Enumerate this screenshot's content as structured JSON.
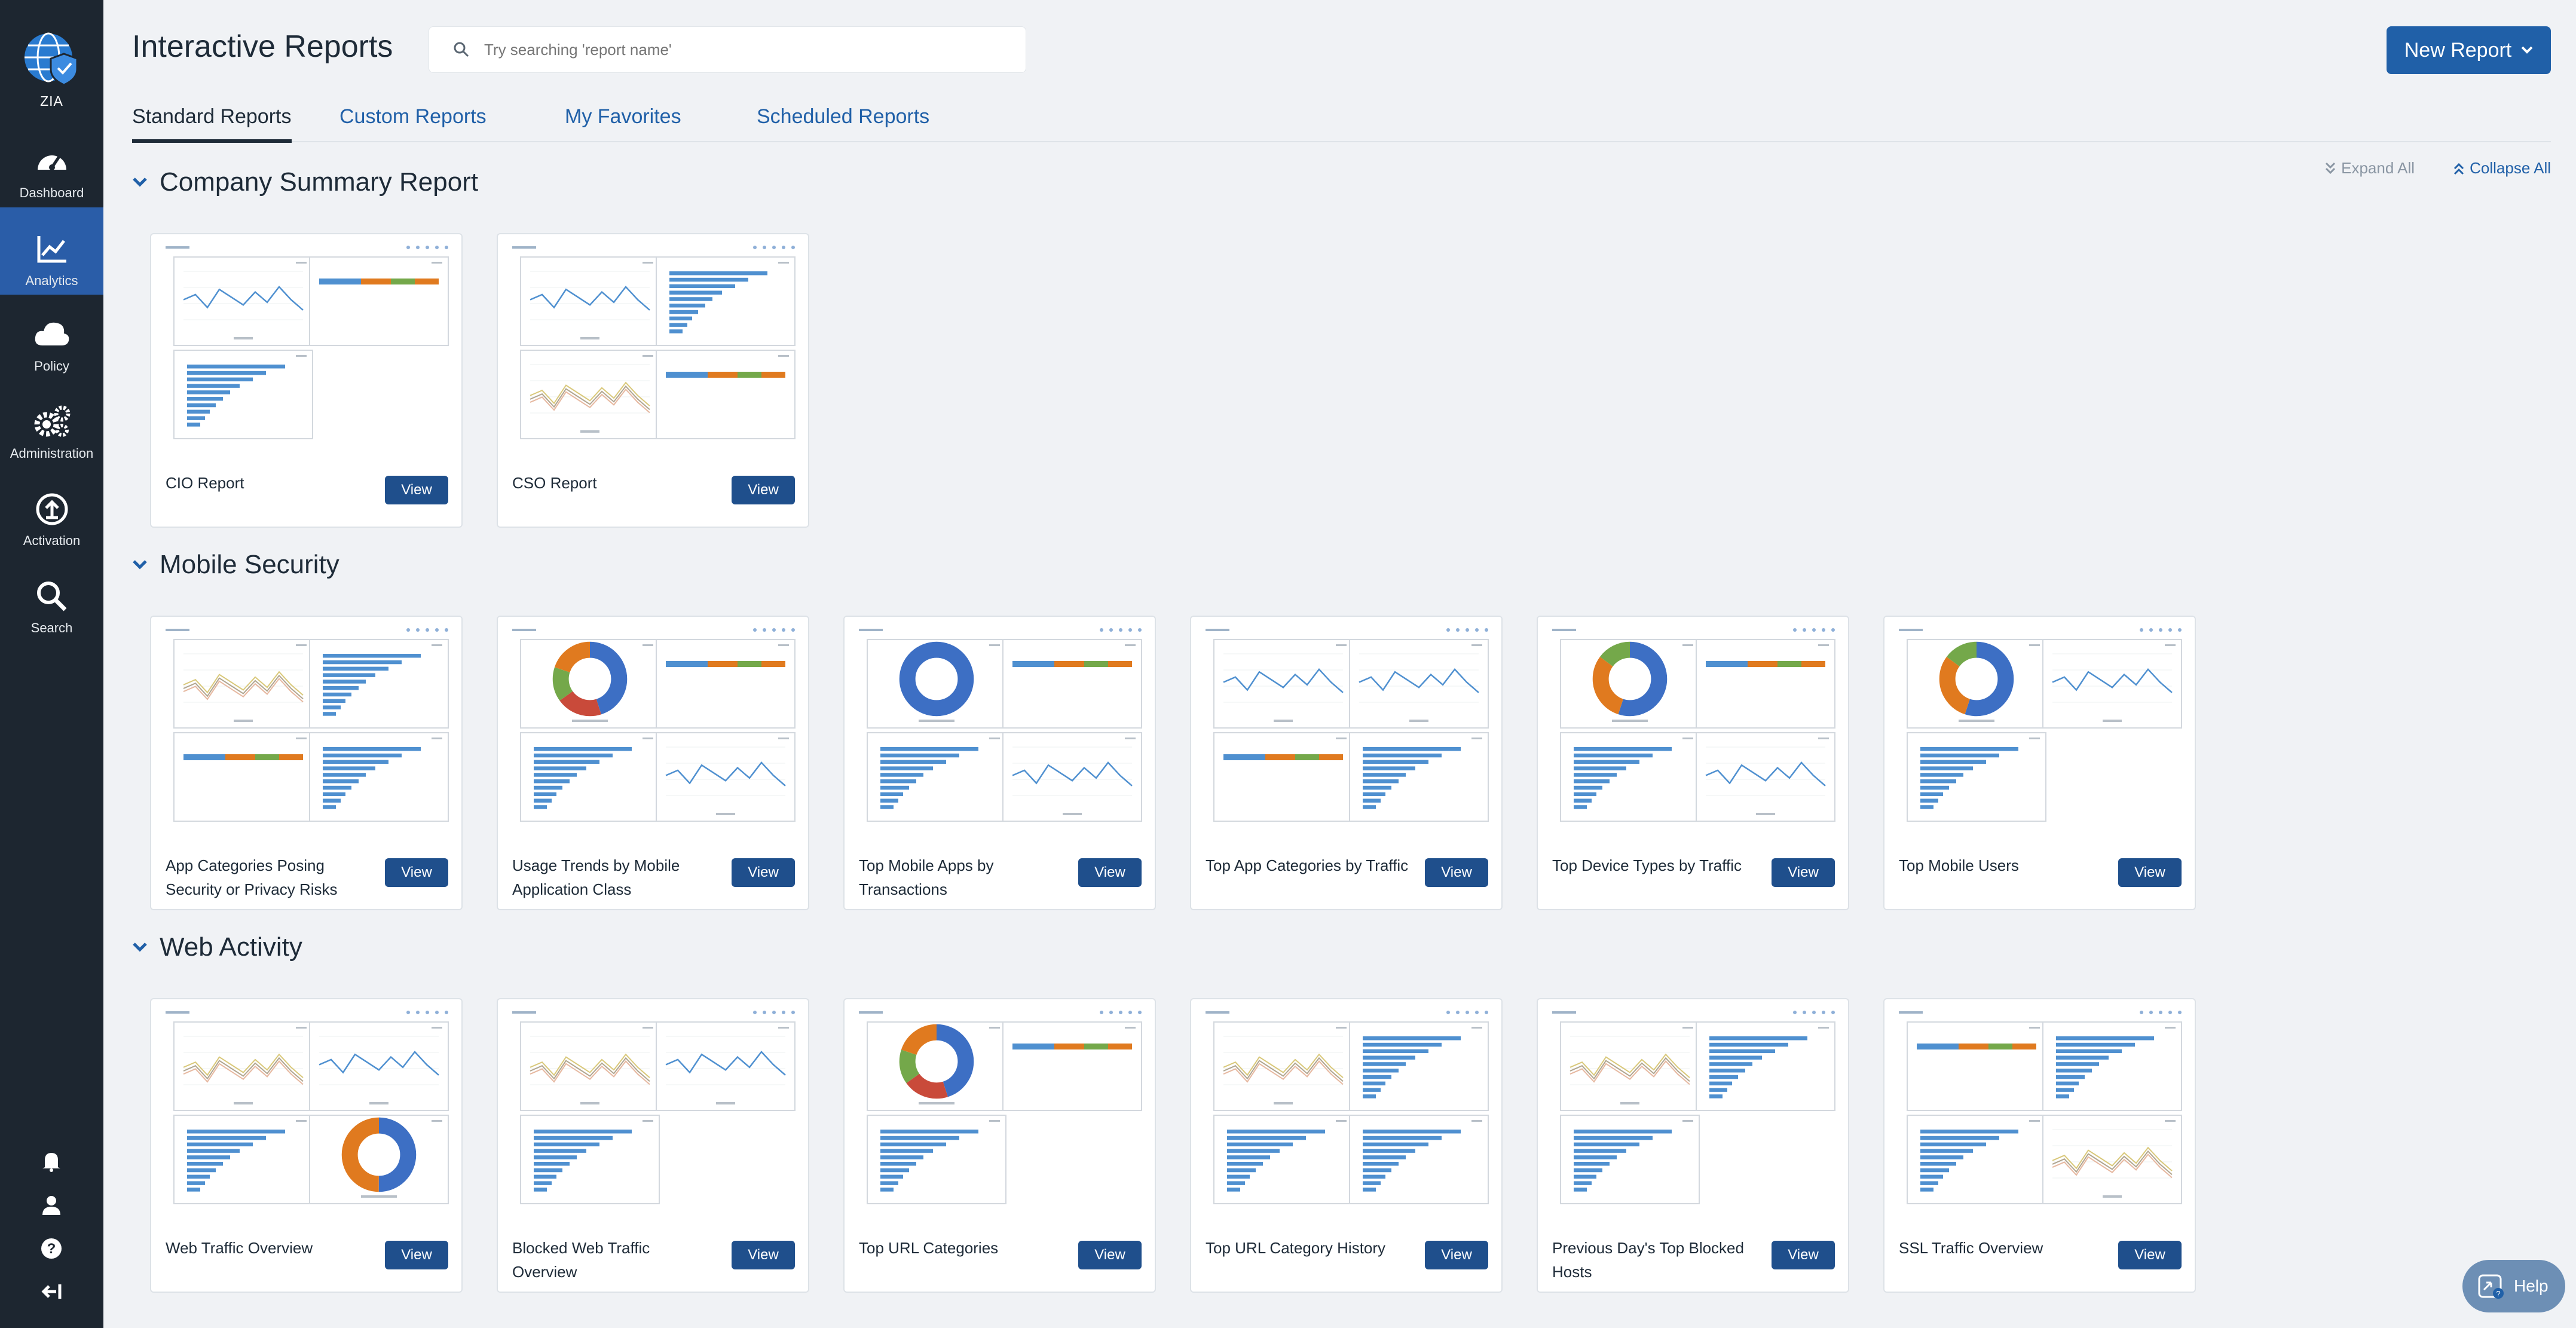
{
  "sidebar": {
    "logo_label": "ZIA",
    "items": [
      {
        "label": "Dashboard",
        "icon": "dashboard-icon"
      },
      {
        "label": "Analytics",
        "icon": "analytics-icon"
      },
      {
        "label": "Policy",
        "icon": "cloud-icon"
      },
      {
        "label": "Administration",
        "icon": "gears-icon"
      },
      {
        "label": "Activation",
        "icon": "upload-icon"
      },
      {
        "label": "Search",
        "icon": "search-icon"
      }
    ],
    "bottom_icons": [
      "bell-icon",
      "user-icon",
      "question-icon",
      "logout-icon"
    ]
  },
  "header": {
    "title": "Interactive Reports",
    "search_placeholder": "Try searching 'report name'",
    "new_report_label": "New Report"
  },
  "tabs": [
    {
      "label": "Standard Reports",
      "active": true
    },
    {
      "label": "Custom Reports"
    },
    {
      "label": "My Favorites"
    },
    {
      "label": "Scheduled Reports"
    }
  ],
  "controls": {
    "expand_all": "Expand All",
    "collapse_all": "Collapse All"
  },
  "view_label": "View",
  "sections": [
    {
      "title": "Company Summary Report",
      "cards": [
        {
          "name": "CIO Report",
          "panels": [
            "line",
            "hbar",
            "bars",
            "empty"
          ]
        },
        {
          "name": "CSO Report",
          "panels": [
            "line",
            "bars",
            "multiline",
            "hbar"
          ]
        }
      ]
    },
    {
      "title": "Mobile Security",
      "cards": [
        {
          "name": "App Categories Posing Security or Privacy Risks",
          "panels": [
            "multiline",
            "bars",
            "hbar",
            "bars"
          ]
        },
        {
          "name": "Usage Trends by Mobile Application Class",
          "panels": [
            "donut3",
            "hbar",
            "bars",
            "line"
          ]
        },
        {
          "name": "Top Mobile Apps by Transactions",
          "panels": [
            "donut1",
            "hbar",
            "bars",
            "line"
          ]
        },
        {
          "name": "Top App Categories by Traffic",
          "panels": [
            "line",
            "line",
            "hbar",
            "bars"
          ]
        },
        {
          "name": "Top Device Types by Traffic",
          "panels": [
            "donut2",
            "hbar",
            "bars",
            "line"
          ]
        },
        {
          "name": "Top Mobile Users",
          "panels": [
            "donut2",
            "line",
            "bars",
            "empty"
          ]
        }
      ]
    },
    {
      "title": "Web Activity",
      "cards": [
        {
          "name": "Web Traffic Overview",
          "panels": [
            "multiline",
            "line",
            "bars",
            "donut-big"
          ]
        },
        {
          "name": "Blocked Web Traffic Overview",
          "panels": [
            "multiline",
            "line",
            "bars",
            "empty"
          ]
        },
        {
          "name": "Top URL Categories",
          "panels": [
            "donut3",
            "hbar",
            "bars",
            "empty"
          ]
        },
        {
          "name": "Top URL Category History",
          "panels": [
            "multiline",
            "bars",
            "bars",
            "bars"
          ]
        },
        {
          "name": "Previous Day's Top Blocked Hosts",
          "panels": [
            "multiline",
            "bars",
            "bars",
            "empty"
          ]
        },
        {
          "name": "SSL Traffic Overview",
          "panels": [
            "hbar",
            "bars",
            "bars",
            "multiline"
          ]
        }
      ]
    }
  ],
  "help_label": "Help",
  "colors": {
    "sidebar": "#1d2630",
    "active": "#2a5da8",
    "primary": "#2060a8",
    "blue": "#3d6fc4",
    "orange": "#e07a1f",
    "green": "#74a84a",
    "red": "#c94a3a",
    "bar": "#4f90d0"
  }
}
